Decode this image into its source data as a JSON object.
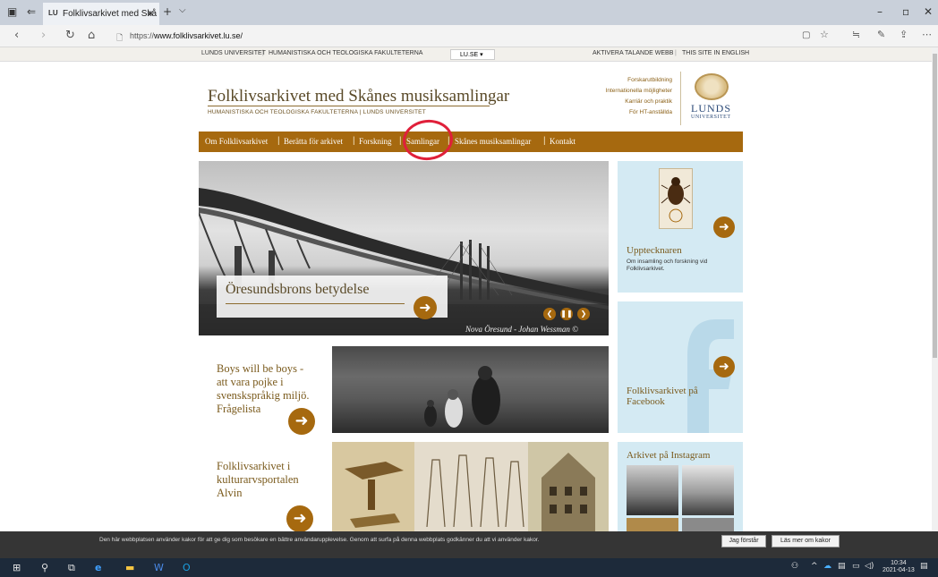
{
  "browser": {
    "tab_title": "Folklivsarkivet med Skå",
    "tab_favicon": "LU",
    "new_tab": "+",
    "tab_menu": "⌵",
    "url_prefix": "https://",
    "url_host": "www.folklivsarkivet.lu.se/",
    "window_min": "–",
    "window_max": "▫",
    "window_close": "✕"
  },
  "sitetop": {
    "lund_university": "LUNDS UNIVERSITET",
    "faculty": "HUMANISTISKA OCH TEOLOGISKA FAKULTETERNA",
    "lu_select": "LU.SE ▾",
    "talking_web": "AKTIVERA TALANDE WEBB",
    "english": "THIS SITE IN ENGLISH"
  },
  "header": {
    "title": "Folklivsarkivet med Skånes musiksamlingar",
    "faculty": "HUMANISTISKA OCH TEOLOGISKA FAKULTETERNA | LUNDS UNIVERSITET",
    "links": [
      "Forskarutbildning",
      "Internationella möjligheter",
      "Karriär och praktik",
      "För HT-anställda"
    ],
    "logo_text": "LUNDS",
    "logo_sub": "UNIVERSITET"
  },
  "nav": {
    "items": [
      "Om Folklivsarkivet",
      "Berätta för arkivet",
      "Forskning",
      "Samlingar",
      "Skånes musiksamlingar",
      "Kontakt"
    ]
  },
  "hero": {
    "caption": "Öresundsbrons betydelse",
    "credit": "Nova Öresund - Johan Wessman ©"
  },
  "sidebar": {
    "uppteck_title": "Upptecknaren",
    "uppteck_text": "Om insamling och forskning vid Folklivsarkivet.",
    "facebook_title": "Folklivsarkivet på Facebook",
    "instagram_title": "Arkivet på Instagram"
  },
  "rows": {
    "boys_title": "Boys will be boys - att vara pojke i svenskspråkig miljö. Frågelista",
    "alvin_title": "Folklivsarkivet i kulturarvsportalen Alvin"
  },
  "cookie": {
    "text": "Den här webbplatsen använder kakor för att ge dig som besökare en bättre användarupplevelse. Genom att surfa på denna webbplats godkänner du att vi använder kakor.",
    "accept": "Jag förstår",
    "more": "Läs mer om kakor"
  },
  "taskbar": {
    "time": "10:34",
    "date": "2021-04-13"
  },
  "colors": {
    "brand_brown": "#a6690f",
    "card_blue": "#d4eaf3",
    "highlight_red": "#e0203a"
  }
}
